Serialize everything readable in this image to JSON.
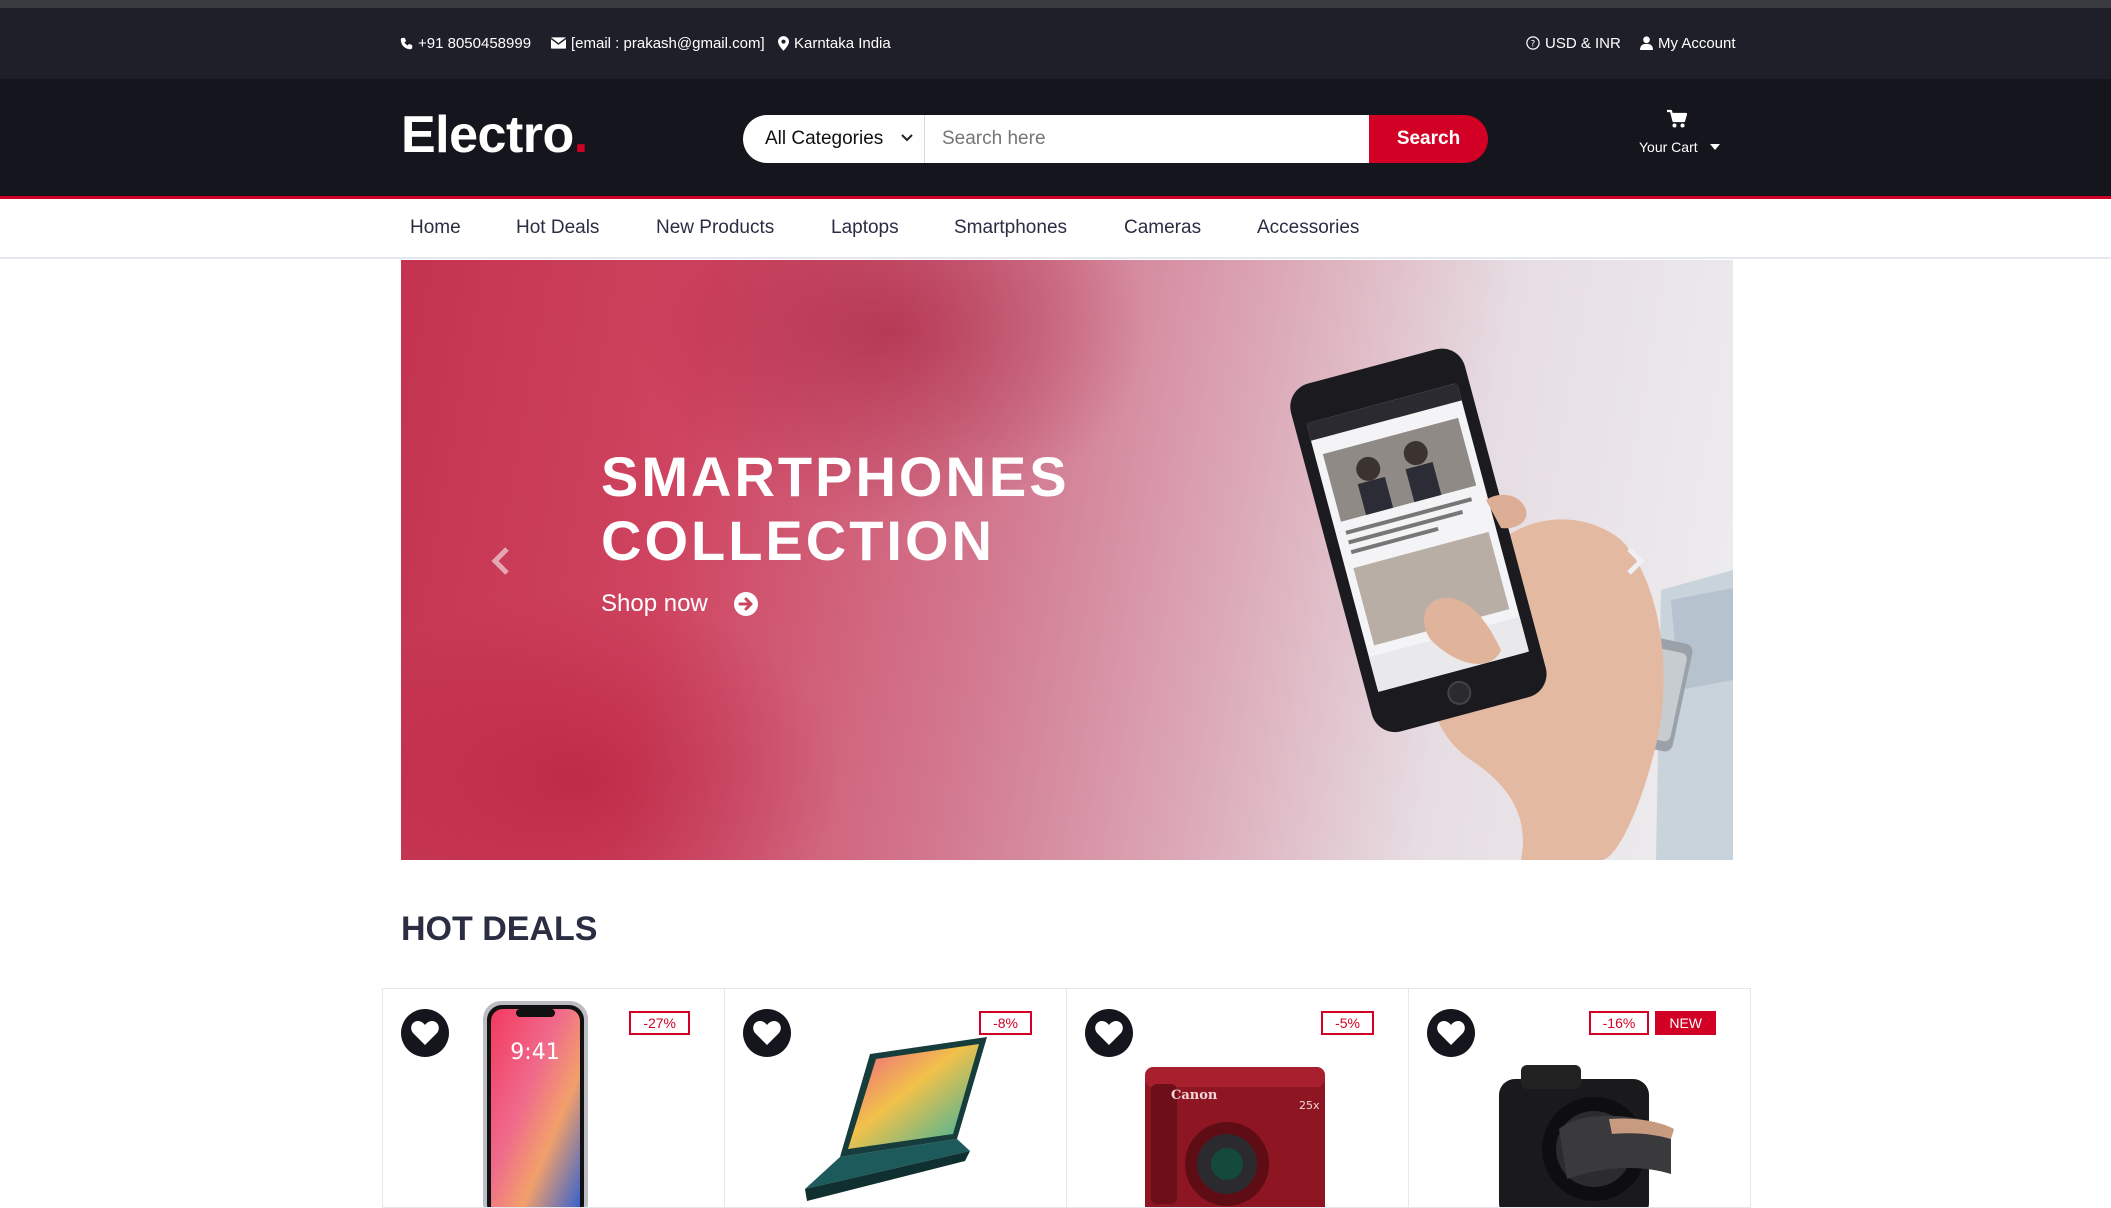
{
  "topbar": {
    "phone": "+91 8050458999",
    "email": "[email : prakash@gmail.com]",
    "location": "Karntaka India",
    "currency": "USD & INR",
    "account": "My Account"
  },
  "header": {
    "logo_text": "Electro",
    "logo_dot": ".",
    "category_selected": "All Categories",
    "search_placeholder": "Search here",
    "search_button": "Search",
    "cart_label": "Your Cart"
  },
  "nav": {
    "items": [
      "Home",
      "Hot Deals",
      "New Products",
      "Laptops",
      "Smartphones",
      "Cameras",
      "Accessories"
    ]
  },
  "banner": {
    "title_line1": "SMARTPHONES",
    "title_line2": "COLLECTION",
    "cta": "Shop now"
  },
  "hot_deals": {
    "title": "HOT DEALS",
    "products": [
      {
        "discount": "-27%",
        "new": "",
        "image": "iphone"
      },
      {
        "discount": "-8%",
        "new": "",
        "image": "laptop"
      },
      {
        "discount": "-5%",
        "new": "",
        "image": "canon-camera"
      },
      {
        "discount": "-16%",
        "new": "NEW",
        "image": "dslr-camera"
      }
    ]
  },
  "colors": {
    "accent": "#d10024",
    "topbar_bg": "#1e1f29",
    "header_bg": "#15161d",
    "text_dark": "#2b2d42"
  },
  "icons": {
    "phone": "phone-icon",
    "email": "envelope-icon",
    "location": "map-marker-icon",
    "currency": "question-circle-icon",
    "account": "user-icon",
    "cart": "shopping-cart-icon",
    "wishlist": "heart-icon",
    "shop_now": "arrow-circle-right-icon"
  }
}
